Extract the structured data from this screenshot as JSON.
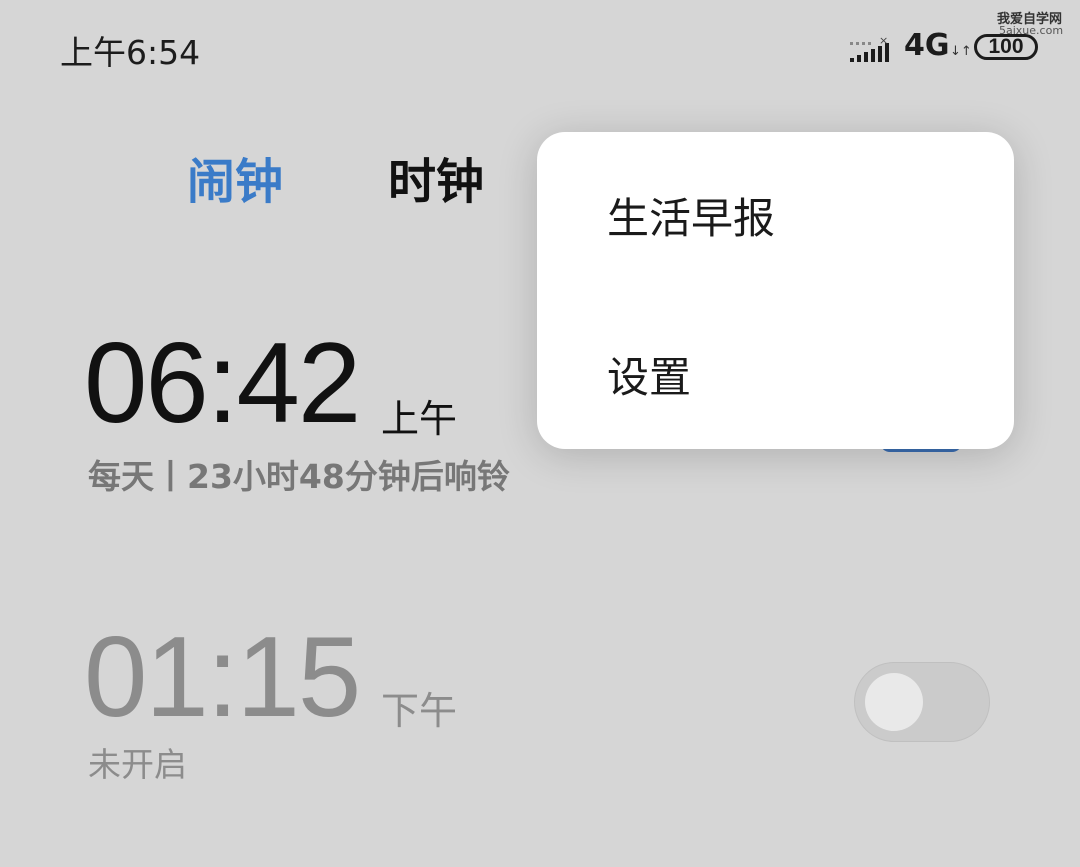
{
  "status_bar": {
    "time": "上午6:54",
    "network": "4G",
    "network_arrows": "↓↑",
    "battery": "100",
    "signal_icon": "signal-bars-icon"
  },
  "watermark": {
    "line1": "我爱自学网",
    "line2": "5aixue.com"
  },
  "tabs": [
    {
      "label": "闹钟",
      "active": true
    },
    {
      "label": "时钟",
      "active": false
    }
  ],
  "alarms": [
    {
      "time": "06:42",
      "ampm": "上午",
      "description": "每天丨23小时48分钟后响铃",
      "enabled": true
    },
    {
      "time": "01:15",
      "ampm": "下午",
      "description": "未开启",
      "enabled": false
    }
  ],
  "menu": {
    "items": [
      {
        "label": "生活早报"
      },
      {
        "label": "设置"
      }
    ]
  },
  "colors": {
    "accent": "#3a7bc8",
    "background": "#d6d6d6",
    "popup": "#ffffff"
  }
}
